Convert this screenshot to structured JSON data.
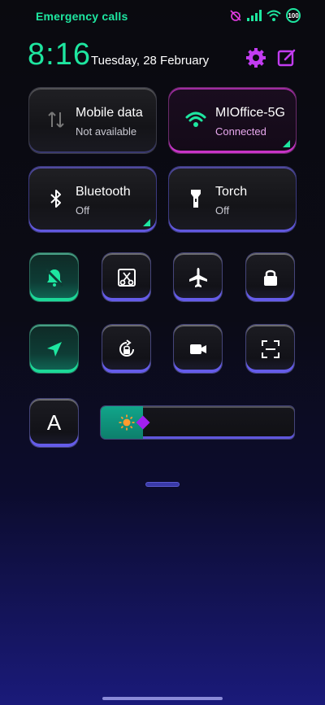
{
  "status_bar": {
    "carrier": "Emergency calls",
    "battery": "100"
  },
  "header": {
    "time": "8:16",
    "date": "Tuesday, 28 February"
  },
  "tiles": {
    "mobile_data": {
      "title": "Mobile data",
      "status": "Not available"
    },
    "wifi": {
      "title": "MIOffice-5G",
      "status": "Connected"
    },
    "bluetooth": {
      "title": "Bluetooth",
      "status": "Off"
    },
    "torch": {
      "title": "Torch",
      "status": "Off"
    }
  },
  "quick_toggles": [
    {
      "name": "silent-icon",
      "active": true
    },
    {
      "name": "screenshot-icon",
      "active": false
    },
    {
      "name": "airplane-icon",
      "active": false
    },
    {
      "name": "lock-icon",
      "active": false
    },
    {
      "name": "location-icon",
      "active": true
    },
    {
      "name": "auto-rotate-icon",
      "active": false
    },
    {
      "name": "screen-recorder-icon",
      "active": false
    },
    {
      "name": "scanner-icon",
      "active": false
    }
  ],
  "font_button": {
    "label": "A"
  },
  "brightness": {
    "level": 0.22
  },
  "colors": {
    "accent_green": "#1ee6a0",
    "accent_pink": "#e63ce6",
    "accent_blue": "#6e64ff"
  }
}
